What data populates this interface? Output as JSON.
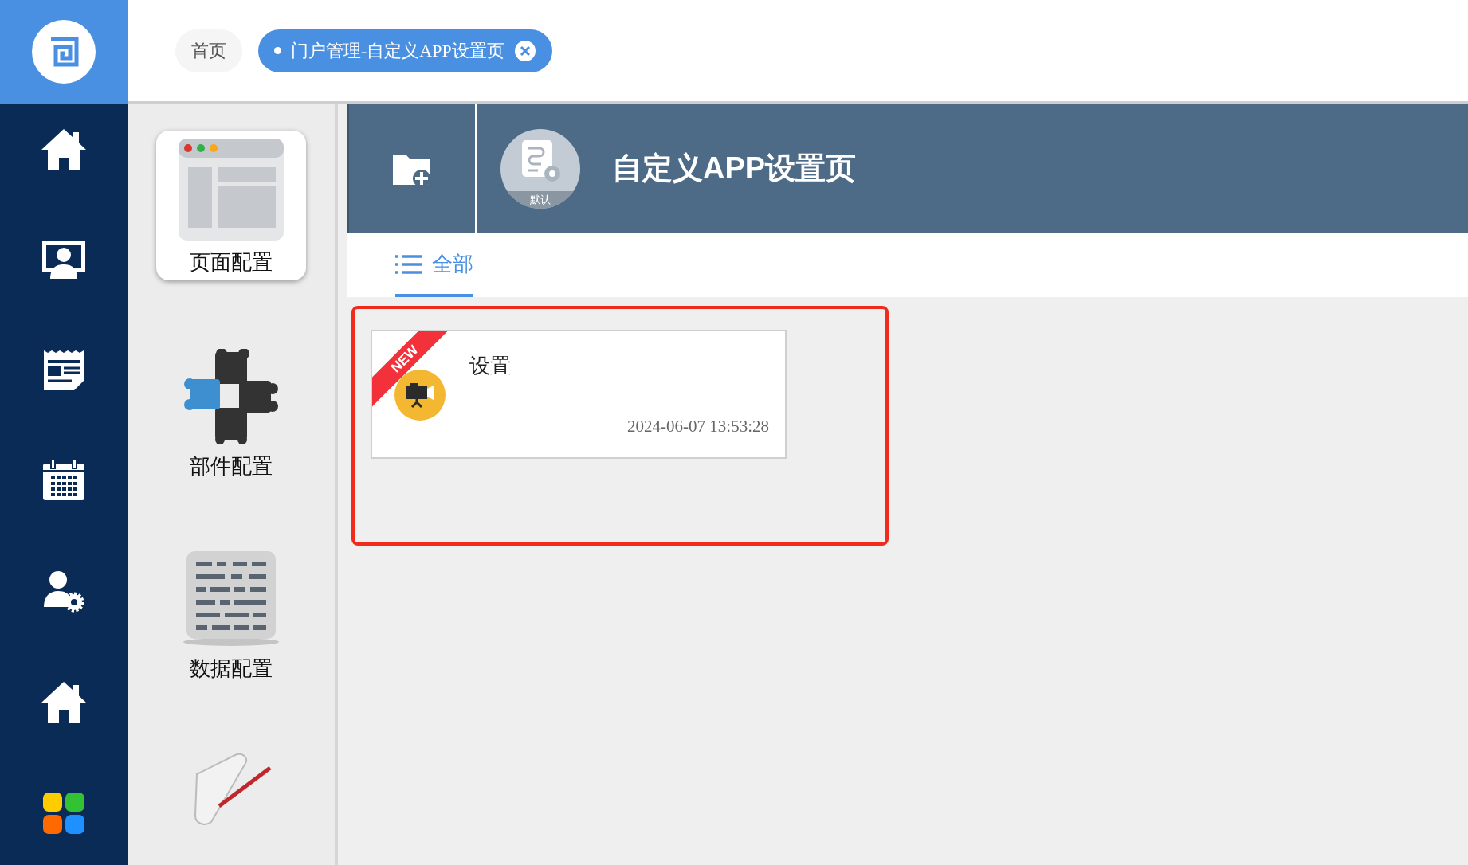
{
  "sidebar": {
    "items": [
      {
        "kind": "home",
        "selected": false
      },
      {
        "kind": "monitor-user",
        "selected": false
      },
      {
        "kind": "news",
        "selected": false
      },
      {
        "kind": "calendar",
        "selected": false
      },
      {
        "kind": "user-settings",
        "selected": false
      },
      {
        "kind": "home",
        "selected": false
      },
      {
        "kind": "apps",
        "selected": false
      }
    ]
  },
  "tabs": [
    {
      "label": "首页",
      "selected": false,
      "closable": false
    },
    {
      "label": "门户管理-自定义APP设置页",
      "selected": true,
      "closable": true
    }
  ],
  "config_menu": {
    "items": [
      {
        "kind": "page",
        "label": "页面配置",
        "selected": true
      },
      {
        "kind": "component",
        "label": "部件配置",
        "selected": false
      },
      {
        "kind": "data",
        "label": "数据配置",
        "selected": false
      },
      {
        "kind": "document",
        "selected": false
      }
    ]
  },
  "header": {
    "title": "自定义APP设置页",
    "badge": "默认"
  },
  "filter_tabs": [
    {
      "label": "全部",
      "selected": true
    }
  ],
  "cards": [
    {
      "title": "设置",
      "date": "2024-06-07 13:53:28",
      "ribbon": "NEW"
    }
  ]
}
